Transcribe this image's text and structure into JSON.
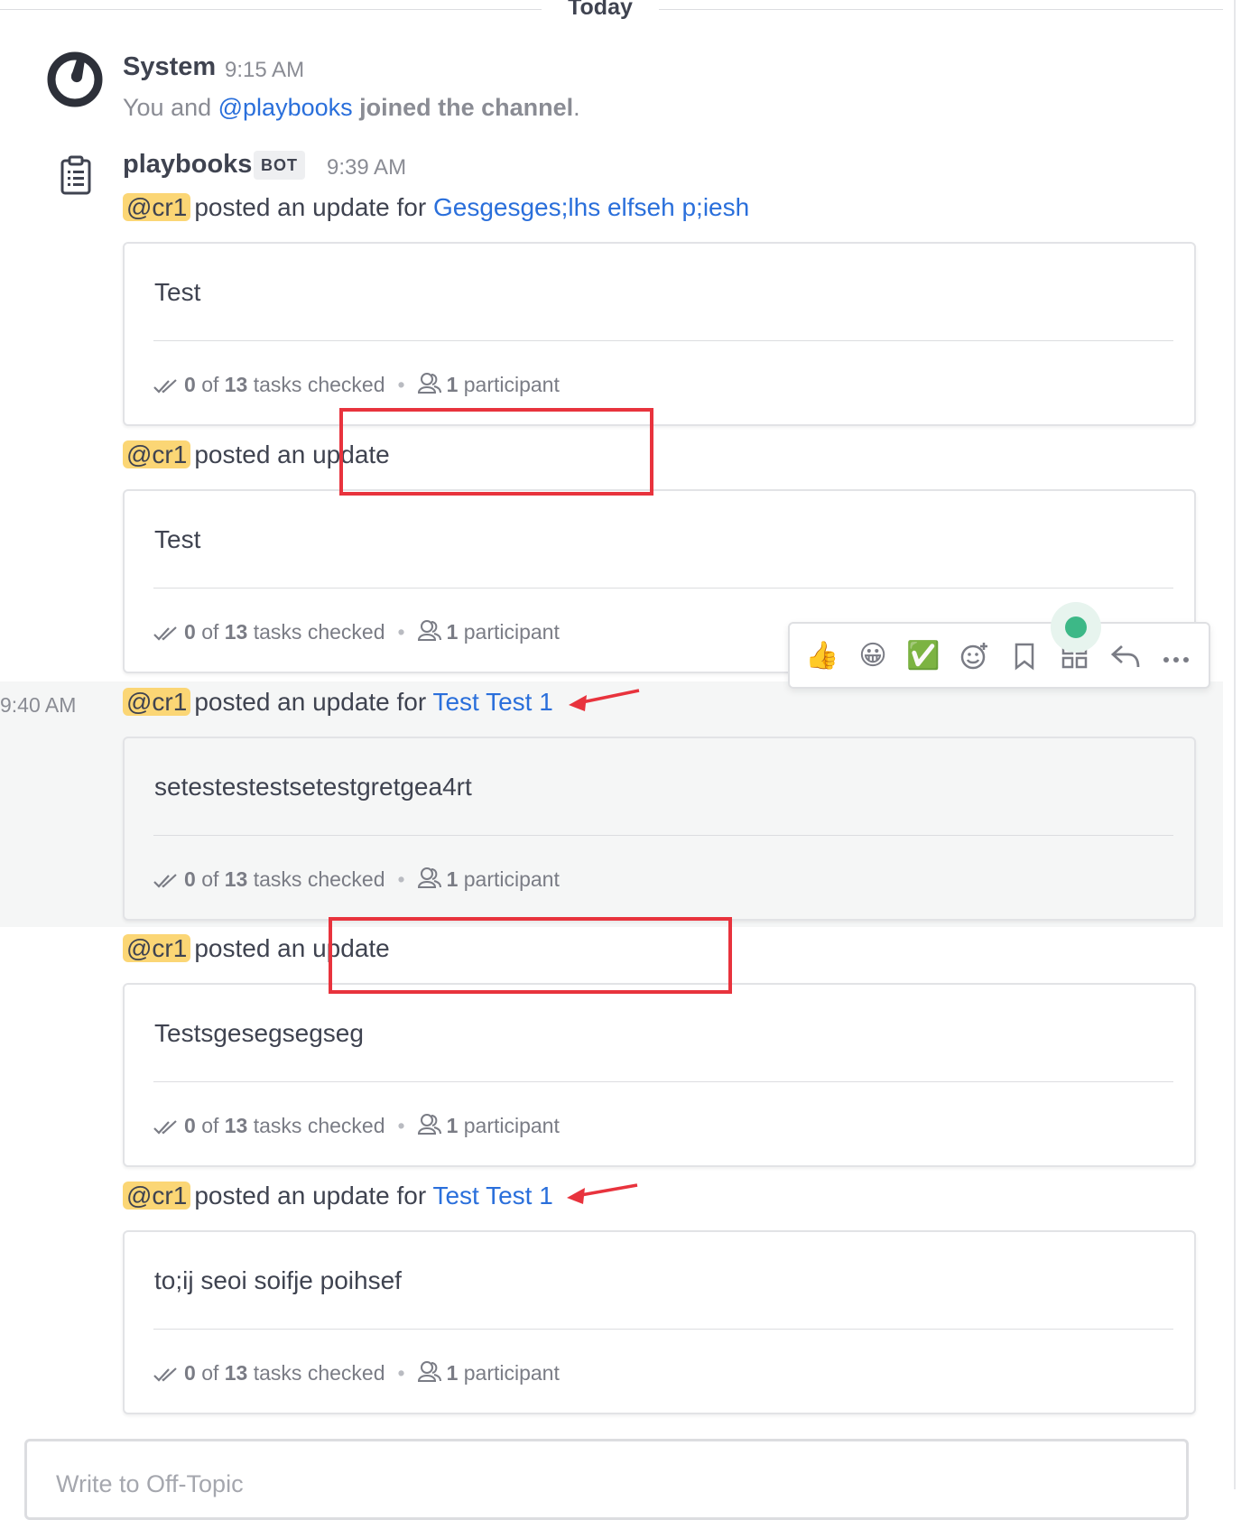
{
  "date_separator": "Today",
  "system_post": {
    "author": "System",
    "time": "9:15 AM",
    "message_prefix": "You and ",
    "mention": "@playbooks",
    "message_suffix": " joined the channel",
    "message_end": "."
  },
  "bot_post": {
    "author": "playbooks",
    "badge": "BOT",
    "time": "9:39 AM"
  },
  "side_time": "9:40 AM",
  "updates": [
    {
      "mention": "@cr1",
      "text": "posted an update for ",
      "run": "Gesgesges;lhs elfseh p;iesh",
      "body": "Test",
      "tasks_done": "0",
      "tasks_of": "of",
      "tasks_total": "13",
      "tasks_label": "tasks checked",
      "participants": "1",
      "participants_label": "participant"
    },
    {
      "mention": "@cr1",
      "text": "posted an update",
      "run": "",
      "body": "Test",
      "tasks_done": "0",
      "tasks_of": "of",
      "tasks_total": "13",
      "tasks_label": "tasks checked",
      "participants": "1",
      "participants_label": "participant"
    },
    {
      "mention": "@cr1",
      "text": "posted an update for ",
      "run": "Test Test 1",
      "body": "setestestestsetestgretgea4rt",
      "tasks_done": "0",
      "tasks_of": "of",
      "tasks_total": "13",
      "tasks_label": "tasks checked",
      "participants": "1",
      "participants_label": "participant"
    },
    {
      "mention": "@cr1",
      "text": "posted an update",
      "run": "",
      "body": "Testsgesegsegseg",
      "tasks_done": "0",
      "tasks_of": "of",
      "tasks_total": "13",
      "tasks_label": "tasks checked",
      "participants": "1",
      "participants_label": "participant"
    },
    {
      "mention": "@cr1",
      "text": "posted an update for ",
      "run": "Test Test 1",
      "body": "to;ij seoi soifje poihsef",
      "tasks_done": "0",
      "tasks_of": "of",
      "tasks_total": "13",
      "tasks_label": "tasks checked",
      "participants": "1",
      "participants_label": "participant"
    }
  ],
  "post_menu": {
    "emojis": [
      "👍",
      "😀",
      "✅"
    ],
    "icons": [
      "add-reaction-icon",
      "bookmark-icon",
      "apps-icon",
      "reply-icon",
      "more-icon"
    ]
  },
  "composer": {
    "placeholder": "Write to Off-Topic"
  },
  "colors": {
    "accent_link": "#2a6fdb",
    "mention_bg": "#fbd675",
    "annotation_red": "#e8333d",
    "online_green": "#3db887"
  }
}
